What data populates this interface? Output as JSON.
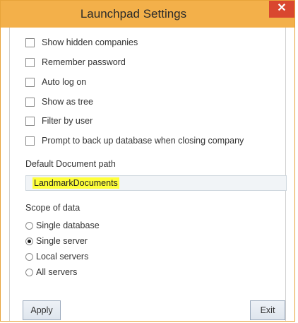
{
  "window": {
    "title": "Launchpad Settings",
    "close_glyph": "✕"
  },
  "options": [
    {
      "label": "Show hidden companies",
      "checked": false
    },
    {
      "label": "Remember password",
      "checked": false
    },
    {
      "label": "Auto log on",
      "checked": false
    },
    {
      "label": "Show as tree",
      "checked": false
    },
    {
      "label": "Filter by user",
      "checked": false
    },
    {
      "label": "Prompt to back up database when closing company",
      "checked": false
    }
  ],
  "document_path": {
    "label": "Default Document path",
    "value": "LandmarkDocuments"
  },
  "scope": {
    "label": "Scope of data",
    "selected": "Single server",
    "options": [
      "Single database",
      "Single server",
      "Local servers",
      "All servers"
    ]
  },
  "buttons": {
    "apply": "Apply",
    "exit": "Exit"
  }
}
